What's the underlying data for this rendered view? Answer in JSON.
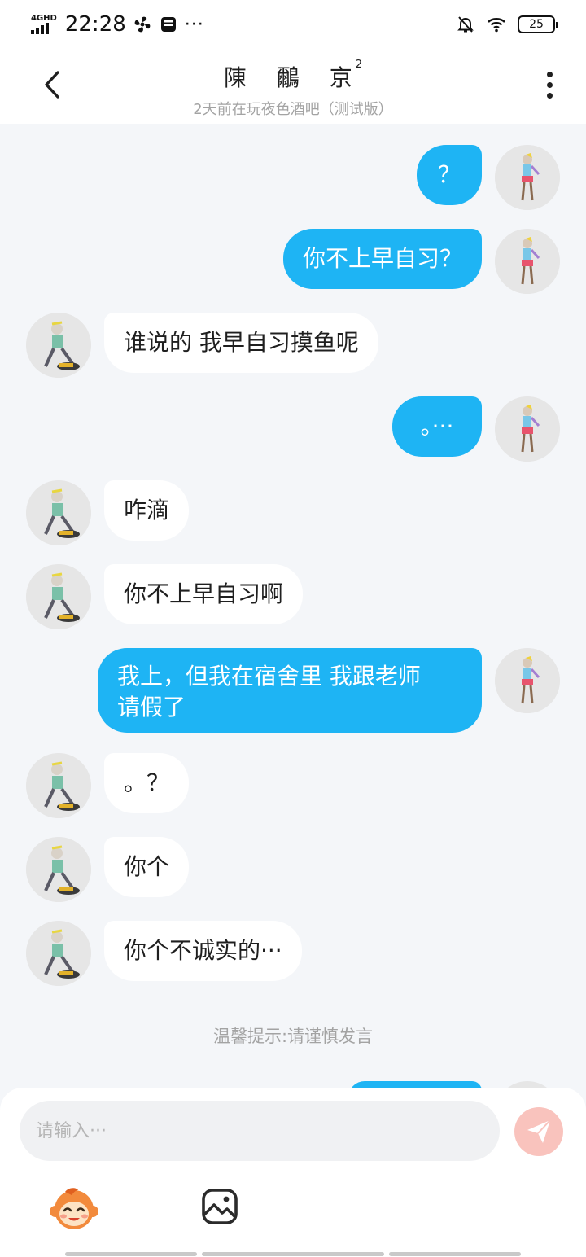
{
  "status_bar": {
    "network": "4GHD",
    "time": "22:28",
    "more": "···",
    "battery": "25"
  },
  "header": {
    "title": "陳 鸍 京",
    "title_sup": "2",
    "subtitle": "2天前在玩夜色酒吧（测试版）"
  },
  "messages": [
    {
      "side": "out",
      "text": "？"
    },
    {
      "side": "out",
      "text": "你不上早自习？"
    },
    {
      "side": "in",
      "text": "谁说的  我早自习摸鱼呢"
    },
    {
      "side": "out",
      "text": "。···"
    },
    {
      "side": "in",
      "text": "咋滴"
    },
    {
      "side": "in",
      "text": "你不上早自习啊"
    },
    {
      "side": "out",
      "text": "我上，但我在宿舍里 我跟老师\n请假了"
    },
    {
      "side": "in",
      "text": "。？"
    },
    {
      "side": "in",
      "text": "你个"
    },
    {
      "side": "in",
      "text": "你个不诚实的···"
    }
  ],
  "tip": "温馨提示:请谨慎发言",
  "input": {
    "placeholder": "请输入···"
  },
  "icons": {
    "back": "chevron-left-icon",
    "more": "more-vertical-icon",
    "send": "send-icon",
    "emoji": "monkey-emoji-icon",
    "image": "image-icon"
  },
  "colors": {
    "outgoing_bubble": "#1eb4f4",
    "incoming_bubble": "#ffffff",
    "background": "#f4f6f9",
    "send_button": "#f9c3bd"
  }
}
